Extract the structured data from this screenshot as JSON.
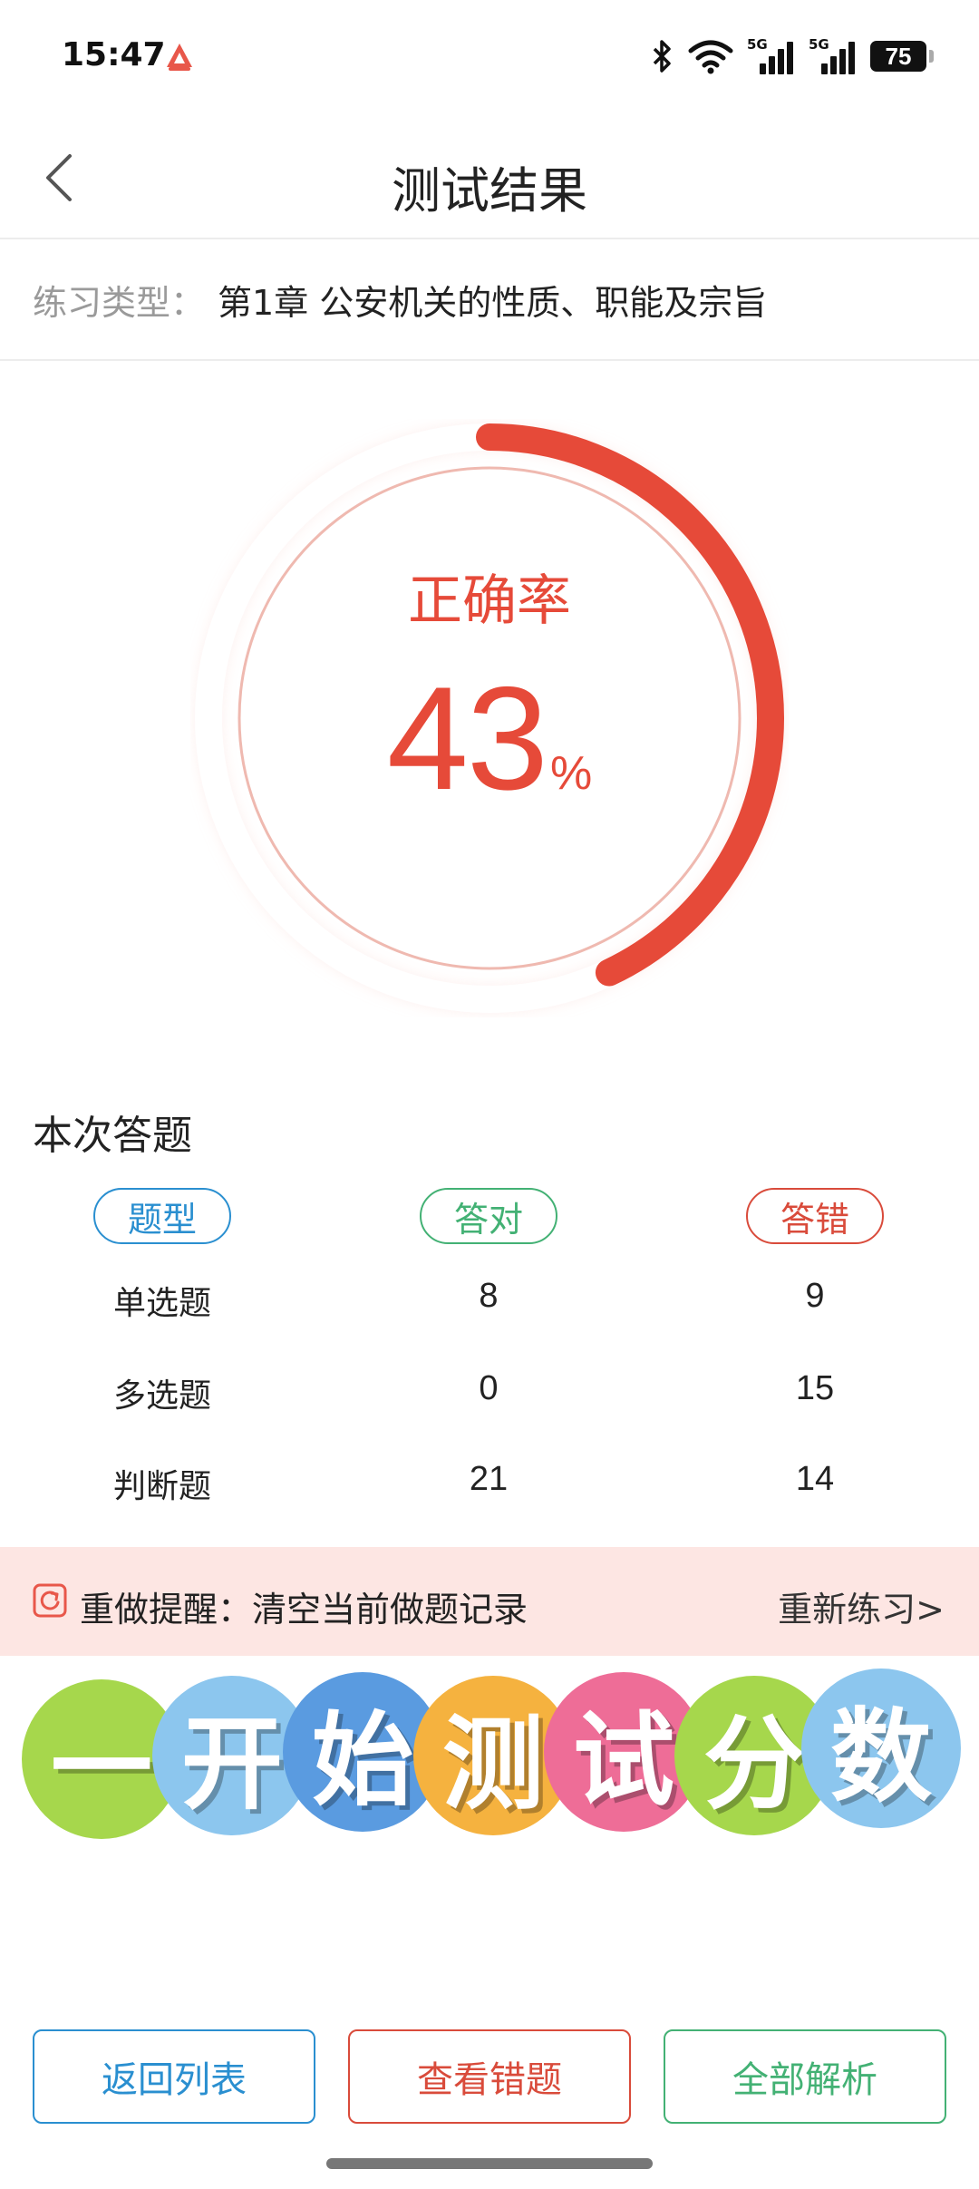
{
  "status_bar": {
    "time": "15:47",
    "battery": "75",
    "network_tags": [
      "5G",
      "5G"
    ],
    "icons": [
      "app-logo-icon",
      "bluetooth-icon",
      "wifi-icon",
      "signal-icon",
      "signal-icon",
      "battery-icon"
    ]
  },
  "header": {
    "title": "测试结果",
    "back_icon": "chevron-left-icon"
  },
  "practice": {
    "label": "练习类型：",
    "value": "第1章 公安机关的性质、职能及宗旨"
  },
  "accuracy": {
    "label": "正确率",
    "value": "43",
    "unit": "%",
    "fraction": 0.43,
    "color": "#e64a39"
  },
  "stats": {
    "title": "本次答题",
    "headers": {
      "type": "题型",
      "right": "答对",
      "wrong": "答错"
    },
    "rows": [
      {
        "type": "单选题",
        "right": "8",
        "wrong": "9"
      },
      {
        "type": "多选题",
        "right": "0",
        "wrong": "15"
      },
      {
        "type": "判断题",
        "right": "21",
        "wrong": "14"
      }
    ]
  },
  "redo": {
    "icon": "refresh-icon",
    "text": "重做提醒：清空当前做题记录",
    "link": "重新练习>"
  },
  "banner": {
    "chars": [
      "一",
      "开",
      "始",
      "测",
      "试",
      "分",
      "数"
    ],
    "colors": [
      "#a6d74c",
      "#8cc6ee",
      "#5a9be0",
      "#f5b23f",
      "#ee6d97",
      "#a6d74c",
      "#8cc6ee"
    ]
  },
  "buttons": {
    "back_to_list": "返回列表",
    "view_wrong": "查看错题",
    "all_analysis": "全部解析"
  },
  "colors": {
    "blue": "#2a8fd0",
    "green": "#43b174",
    "red": "#d94b3b",
    "pink_bg": "#fde6e3"
  }
}
